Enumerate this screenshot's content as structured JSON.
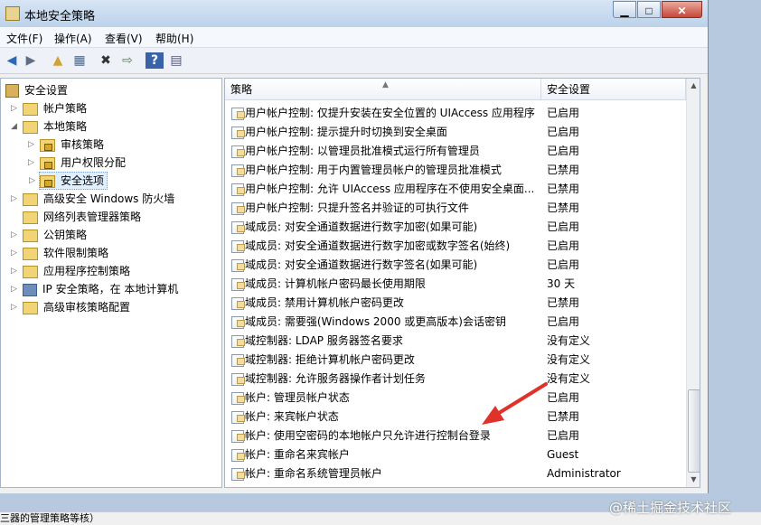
{
  "window": {
    "title": "本地安全策略",
    "min": "▁",
    "max": "□",
    "close": "✕"
  },
  "menu": [
    {
      "label": "文件(F)"
    },
    {
      "label": "操作(A)"
    },
    {
      "label": "查看(V)"
    },
    {
      "label": "帮助(H)"
    }
  ],
  "toolbar": [
    {
      "icon": "back-arrow-icon",
      "glyph": "◀"
    },
    {
      "icon": "forward-arrow-icon",
      "glyph": "▶"
    },
    {
      "icon": "up-folder-icon",
      "glyph": "▲"
    },
    {
      "icon": "show-hide-tree-icon",
      "glyph": "▦"
    },
    {
      "icon": "delete-icon",
      "glyph": "✖"
    },
    {
      "icon": "export-list-icon",
      "glyph": "⇨"
    },
    {
      "icon": "help-icon",
      "glyph": "?"
    },
    {
      "icon": "properties-icon",
      "glyph": "▤"
    }
  ],
  "tree": [
    {
      "label": "安全设置"
    },
    {
      "label": "帐户策略"
    },
    {
      "label": "本地策略"
    },
    {
      "label": "审核策略"
    },
    {
      "label": "用户权限分配"
    },
    {
      "label": "安全选项"
    },
    {
      "label": "高级安全 Windows 防火墙"
    },
    {
      "label": "网络列表管理器策略"
    },
    {
      "label": "公钥策略"
    },
    {
      "label": "软件限制策略"
    },
    {
      "label": "应用程序控制策略"
    },
    {
      "label": "IP 安全策略，在 本地计算机"
    },
    {
      "label": "高级审核策略配置"
    }
  ],
  "list": {
    "columns": {
      "policy": "策略",
      "setting": "安全设置"
    },
    "rows": [
      {
        "policy": "用户帐户控制: 仅提升安装在安全位置的 UIAccess 应用程序",
        "setting": "已启用"
      },
      {
        "policy": "用户帐户控制: 提示提升时切换到安全桌面",
        "setting": "已启用"
      },
      {
        "policy": "用户帐户控制: 以管理员批准模式运行所有管理员",
        "setting": "已启用"
      },
      {
        "policy": "用户帐户控制: 用于内置管理员帐户的管理员批准模式",
        "setting": "已禁用"
      },
      {
        "policy": "用户帐户控制: 允许 UIAccess 应用程序在不使用安全桌面...",
        "setting": "已禁用"
      },
      {
        "policy": "用户帐户控制: 只提升签名并验证的可执行文件",
        "setting": "已禁用"
      },
      {
        "policy": "域成员: 对安全通道数据进行数字加密(如果可能)",
        "setting": "已启用"
      },
      {
        "policy": "域成员: 对安全通道数据进行数字加密或数字签名(始终)",
        "setting": "已启用"
      },
      {
        "policy": "域成员: 对安全通道数据进行数字签名(如果可能)",
        "setting": "已启用"
      },
      {
        "policy": "域成员: 计算机帐户密码最长使用期限",
        "setting": "30 天"
      },
      {
        "policy": "域成员: 禁用计算机帐户密码更改",
        "setting": "已禁用"
      },
      {
        "policy": "域成员: 需要强(Windows 2000 或更高版本)会话密钥",
        "setting": "已启用"
      },
      {
        "policy": "域控制器: LDAP 服务器签名要求",
        "setting": "没有定义"
      },
      {
        "policy": "域控制器: 拒绝计算机帐户密码更改",
        "setting": "没有定义"
      },
      {
        "policy": "域控制器: 允许服务器操作者计划任务",
        "setting": "没有定义"
      },
      {
        "policy": "帐户: 管理员帐户状态",
        "setting": "已启用"
      },
      {
        "policy": "帐户: 来宾帐户状态",
        "setting": "已禁用"
      },
      {
        "policy": "帐户: 使用空密码的本地帐户只允许进行控制台登录",
        "setting": "已启用"
      },
      {
        "policy": "帐户: 重命名来宾帐户",
        "setting": "Guest"
      },
      {
        "policy": "帐户: 重命名系统管理员帐户",
        "setting": "Administrator"
      }
    ]
  },
  "statusbar": {
    "text": "三器的管理策略等核）"
  },
  "watermark": "@稀土掘金技术社区"
}
